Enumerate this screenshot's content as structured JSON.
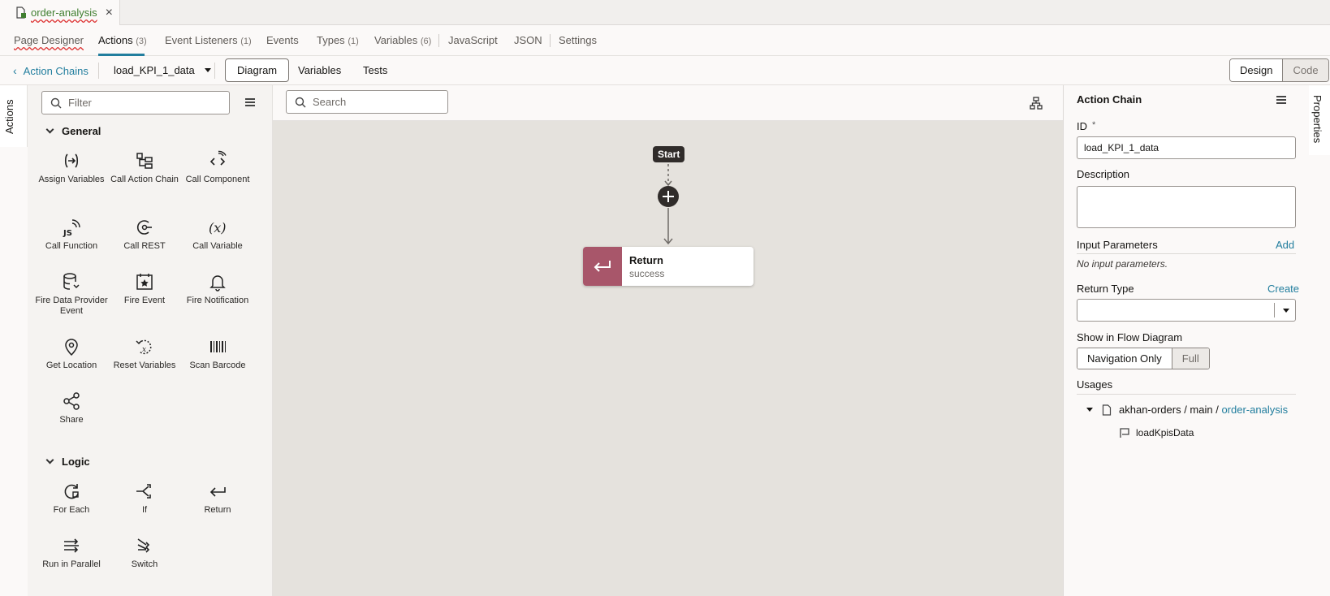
{
  "file_tab": {
    "name": "order-analysis",
    "close": "×"
  },
  "main_tabs": [
    {
      "label": "Page Designer",
      "count": ""
    },
    {
      "label": "Actions",
      "count": "(3)"
    },
    {
      "label": "Event Listeners",
      "count": "(1)"
    },
    {
      "label": "Events",
      "count": ""
    },
    {
      "label": "Types",
      "count": "(1)"
    },
    {
      "label": "Variables",
      "count": "(6)"
    },
    {
      "label": "JavaScript",
      "count": ""
    },
    {
      "label": "JSON",
      "count": ""
    },
    {
      "label": "Settings",
      "count": ""
    }
  ],
  "toolbar": {
    "back_label": "Action Chains",
    "chain_name": "load_KPI_1_data",
    "views": [
      "Diagram",
      "Variables",
      "Tests"
    ],
    "design": "Design",
    "code": "Code"
  },
  "side_tabs": {
    "left": "Actions",
    "right": "Properties"
  },
  "palette": {
    "filter_placeholder": "Filter",
    "general_title": "General",
    "general_items": [
      {
        "label": "Assign Variables",
        "icon": "assign-variables-icon"
      },
      {
        "label": "Call Action Chain",
        "icon": "call-action-chain-icon"
      },
      {
        "label": "Call Component",
        "icon": "call-component-icon"
      },
      {
        "label": "Call Function",
        "icon": "call-function-icon"
      },
      {
        "label": "Call REST",
        "icon": "call-rest-icon"
      },
      {
        "label": "Call Variable",
        "icon": "call-variable-icon"
      },
      {
        "label": "Fire Data Provider Event",
        "icon": "database-icon"
      },
      {
        "label": "Fire Event",
        "icon": "calendar-star-icon"
      },
      {
        "label": "Fire Notification",
        "icon": "bell-icon"
      },
      {
        "label": "Get Location",
        "icon": "location-pin-icon"
      },
      {
        "label": "Reset Variables",
        "icon": "reset-icon"
      },
      {
        "label": "Scan Barcode",
        "icon": "barcode-icon"
      },
      {
        "label": "Share",
        "icon": "share-icon"
      }
    ],
    "logic_title": "Logic",
    "logic_items": [
      {
        "label": "For Each",
        "icon": "loop-icon"
      },
      {
        "label": "If",
        "icon": "branch-icon"
      },
      {
        "label": "Return",
        "icon": "return-icon"
      },
      {
        "label": "Run in Parallel",
        "icon": "parallel-icon"
      },
      {
        "label": "Switch",
        "icon": "switch-icon"
      }
    ]
  },
  "canvas": {
    "search_placeholder": "Search",
    "start_label": "Start",
    "return_title": "Return",
    "return_subtitle": "success"
  },
  "properties": {
    "title": "Action Chain",
    "id_label": "ID",
    "id_required": "*",
    "id_value": "load_KPI_1_data",
    "description_label": "Description",
    "input_params_label": "Input Parameters",
    "add_link": "Add",
    "no_params": "No input parameters.",
    "return_type_label": "Return Type",
    "create_link": "Create",
    "flow_label": "Show in Flow Diagram",
    "flow_options": [
      "Navigation Only",
      "Full"
    ],
    "usages_label": "Usages",
    "usage_path": "akhan-orders / main / ",
    "usage_link": "order-analysis",
    "usage_event": "loadKpisData"
  },
  "colors": {
    "accent": "#227e9e",
    "return_band": "#a8566a",
    "file_name": "#3f7e2f"
  }
}
